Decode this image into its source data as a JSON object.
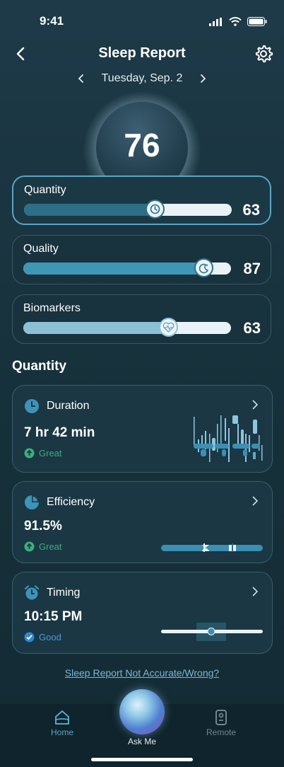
{
  "status": {
    "time": "9:41"
  },
  "header": {
    "title": "Sleep Report",
    "date": "Tuesday, Sep. 2"
  },
  "overall_score": "76",
  "score_cards": [
    {
      "label": "Quantity",
      "value": "63",
      "fill": 0.63,
      "active": true
    },
    {
      "label": "Quality",
      "value": "87",
      "fill": 0.87,
      "active": false
    },
    {
      "label": "Biomarkers",
      "value": "63",
      "fill": 0.7,
      "active": false
    }
  ],
  "section_title": "Quantity",
  "metrics": {
    "duration": {
      "label": "Duration",
      "value": "7 hr 42 min",
      "status": "Great"
    },
    "efficiency": {
      "label": "Efficiency",
      "value": "91.5%",
      "status": "Great"
    },
    "timing": {
      "label": "Timing",
      "value": "10:15 PM",
      "status": "Good"
    }
  },
  "link_text": "Sleep Report Not Accurate/Wrong?",
  "tabs": {
    "home": "Home",
    "ask": "Ask Me",
    "remote": "Remote"
  },
  "colors": {
    "accent": "#5aa6c4",
    "great": "#3cae7a",
    "good": "#2f86d6"
  }
}
